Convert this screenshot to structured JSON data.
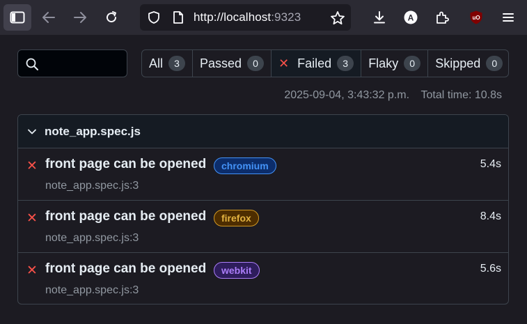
{
  "browser": {
    "url_host": "http://localhost",
    "url_port": ":9323",
    "icons": [
      "sidebar-icon",
      "back-arrow-icon",
      "forward-arrow-icon",
      "reload-icon",
      "shield-icon",
      "page-icon",
      "star-icon",
      "download-icon",
      "account-icon",
      "extensions-icon",
      "ublock-icon",
      "menu-icon"
    ]
  },
  "report": {
    "search_placeholder": "",
    "filters": [
      {
        "label": "All",
        "count": "3"
      },
      {
        "label": "Passed",
        "count": "0"
      },
      {
        "label": "Failed",
        "count": "3"
      },
      {
        "label": "Flaky",
        "count": "0"
      },
      {
        "label": "Skipped",
        "count": "0"
      }
    ],
    "timestamp": "2025-09-04, 3:43:32 p.m.",
    "total_time": "Total time: 10.8s",
    "file": {
      "name": "note_app.spec.js",
      "tests": [
        {
          "status_icon": "✕",
          "title": "front page can be opened",
          "project": "chromium",
          "location": "note_app.spec.js:3",
          "duration": "5.4s"
        },
        {
          "status_icon": "✕",
          "title": "front page can be opened",
          "project": "firefox",
          "location": "note_app.spec.js:3",
          "duration": "8.4s"
        },
        {
          "status_icon": "✕",
          "title": "front page can be opened",
          "project": "webkit",
          "location": "note_app.spec.js:3",
          "duration": "5.6s"
        }
      ]
    }
  },
  "colors": {
    "failed": "#f85149",
    "chromium": "#4493f8",
    "firefox": "#d29922",
    "webkit": "#ab7df8"
  }
}
